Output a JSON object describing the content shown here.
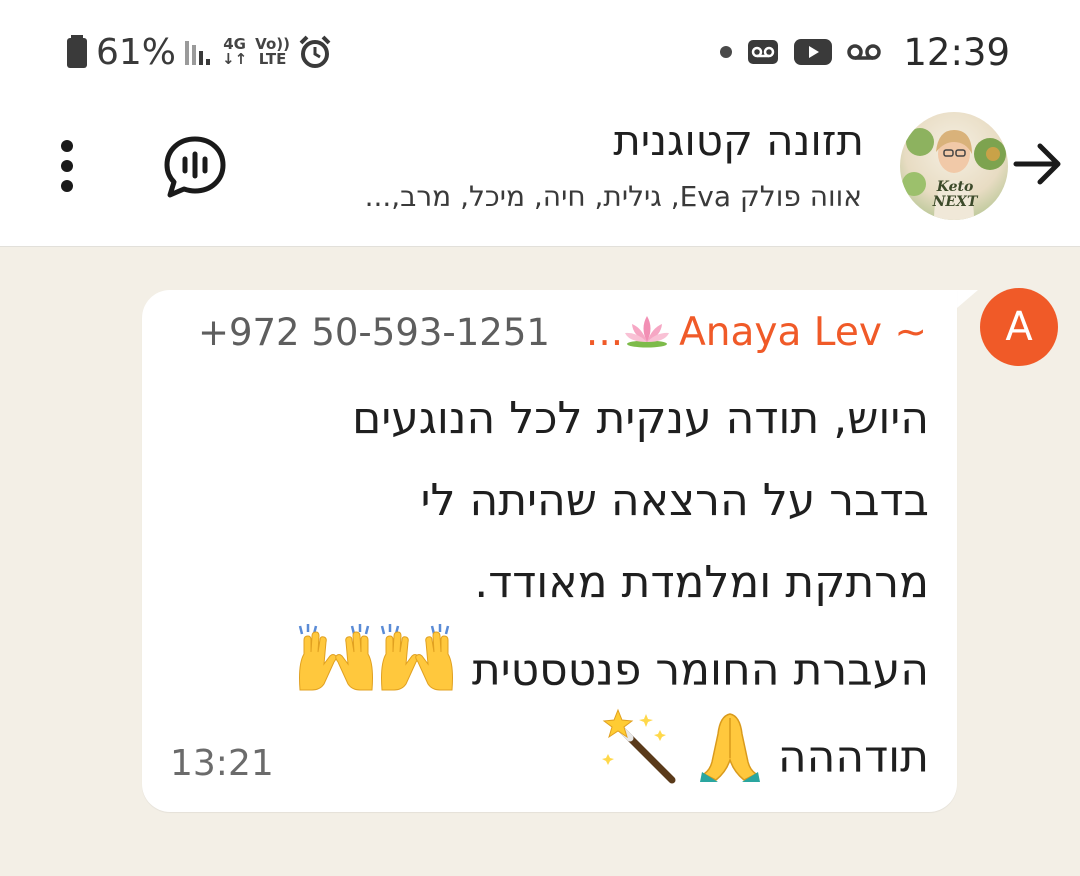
{
  "status_bar": {
    "battery": "61%",
    "network": "4G",
    "volte_top": "Vo))",
    "volte_bottom": "LTE",
    "time": "12:39"
  },
  "header": {
    "group_name": "תזונה קטוגנית",
    "members": "אווה פולק Eva, גילית, חיה, מיכל, מרב,...",
    "avatar_text": "Keto NEXT"
  },
  "message": {
    "sender_initial": "A",
    "sender_name": "~ Anaya Lev",
    "sender_ellipsis": "...",
    "sender_phone": "+972 50-593-1251",
    "lines": [
      "היוש, תודה ענקית לכל הנוגעים",
      "בדבר על הרצאה שהיתה לי",
      "מרתקת ומלמדת מאודד.",
      "העברת החומר פנטסטית",
      "תודההה"
    ],
    "time": "13:21"
  },
  "icons": {
    "back": "arrow-right-icon",
    "menu": "more-vert-icon",
    "chat": "voice-chat-icon",
    "emoji_raise": "raising-hands-icon",
    "emoji_pray": "folded-hands-icon",
    "emoji_wand": "magic-wand-icon",
    "emoji_lotus": "lotus-icon"
  },
  "colors": {
    "accent": "#f05a28",
    "chat_bg": "#f3efe6",
    "bubble": "#ffffff"
  }
}
